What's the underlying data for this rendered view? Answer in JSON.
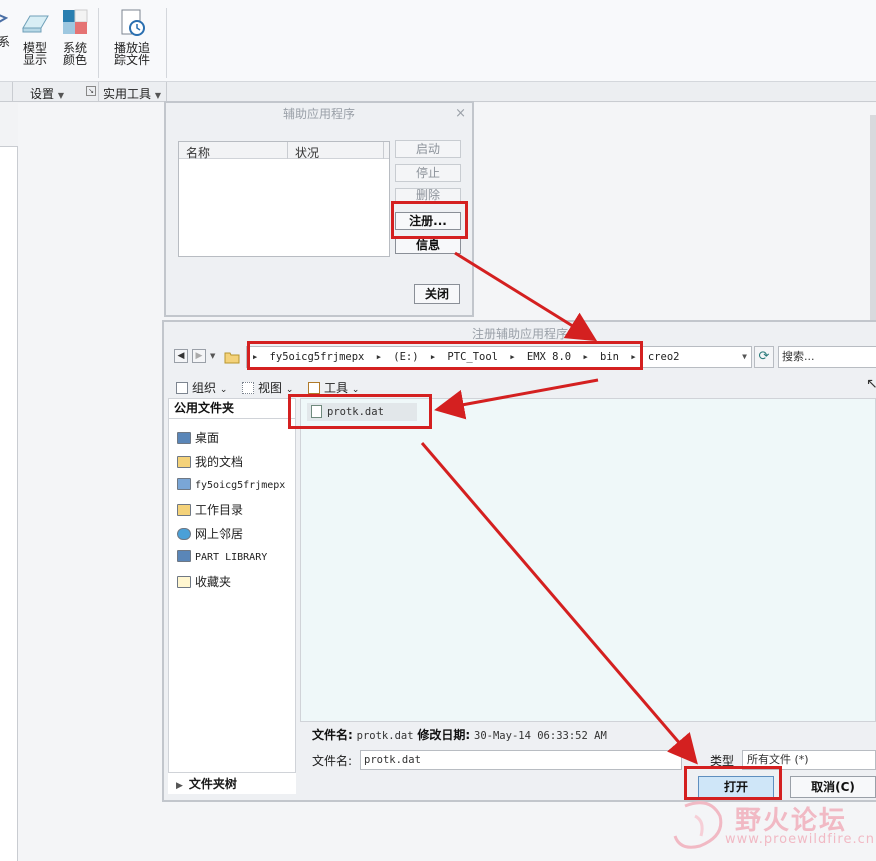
{
  "ribbon": {
    "partial_label": "关系",
    "model_display": "模型显示",
    "system_colors": "系统颜色",
    "play_trail": "播放追踪文件",
    "group_settings": "设置",
    "group_utilities": "实用工具",
    "icons": [
      "partial-icon",
      "model-display-icon",
      "system-colors-icon",
      "play-trail-icon"
    ]
  },
  "aux_dialog": {
    "title": "辅助应用程序",
    "col_name": "名称",
    "col_status": "状况",
    "btn_start": "启动",
    "btn_stop": "停止",
    "btn_delete": "删除",
    "btn_register": "注册...",
    "btn_info": "信息",
    "btn_close": "关闭"
  },
  "register_dialog": {
    "title": "注册辅助应用程序",
    "breadcrumbs": [
      "fy5oicg5frjmepx",
      "(E:)",
      "PTC_Tool",
      "EMX 8.0",
      "bin",
      "creo2"
    ],
    "search_placeholder": "搜索...",
    "toolbar": {
      "organize": "组织",
      "view": "视图",
      "tools": "工具"
    },
    "places_header": "公用文件夹",
    "places": [
      "桌面",
      "我的文档",
      "fy5oicg5frjmepx",
      "工作目录",
      "网上邻居",
      "PART LIBRARY",
      "收藏夹"
    ],
    "folder_tree": "文件夹树",
    "files": [
      "protk.dat"
    ],
    "info_label_filename": "文件名:",
    "info_filename": "protk.dat",
    "info_label_modified": "修改日期:",
    "info_modified": "30-May-14 06:33:52 AM",
    "filename_label": "文件名:",
    "filename_value": "protk.dat",
    "type_label": "类型",
    "type_value": "所有文件 (*)",
    "btn_open": "打开",
    "btn_cancel": "取消(C)"
  },
  "watermark": {
    "text": "野火论坛",
    "url": "www.proewildfire.cn"
  },
  "colors": {
    "highlight": "#d42020",
    "open_button": "#cfe6f8",
    "file_area": "#eff8f9"
  }
}
